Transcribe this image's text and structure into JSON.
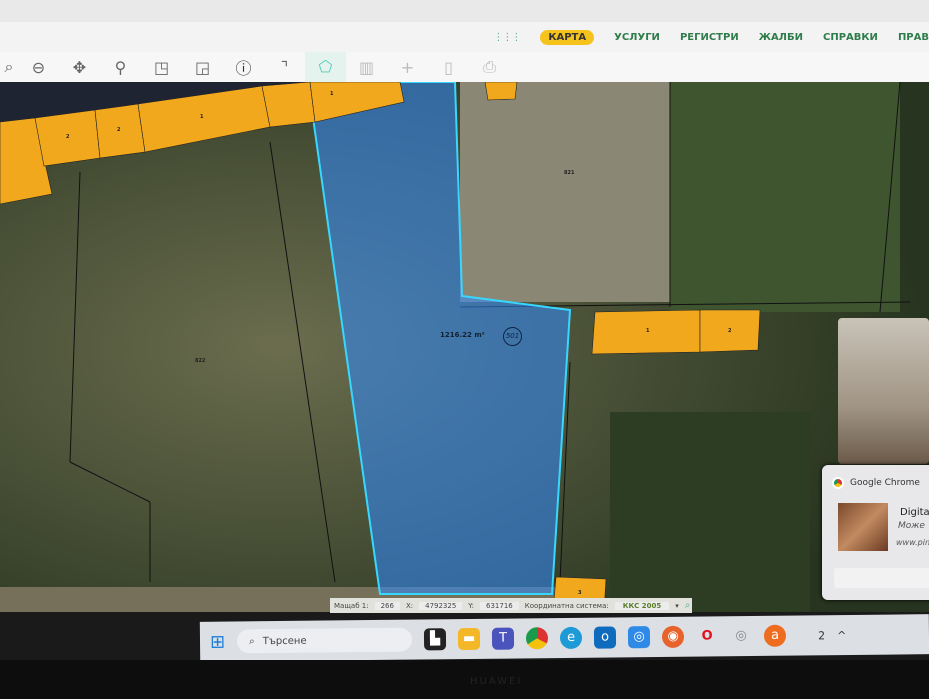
{
  "nav": {
    "items": [
      "КАРТА",
      "УСЛУГИ",
      "РЕГИСТРИ",
      "ЖАЛБИ",
      "СПРАВКИ",
      "ПРАВ"
    ],
    "active": "КАРТА",
    "accent": "#f6c31d",
    "link_color": "#2f7d4a"
  },
  "toolbar": {
    "tools": [
      "zoom-in",
      "zoom-out",
      "pan",
      "marker",
      "select-rect",
      "select-rect-2",
      "info",
      "measure-line",
      "measure-polygon",
      "map-layers",
      "crosshair",
      "document",
      "print"
    ],
    "active": "measure-polygon"
  },
  "map": {
    "parcel_labels": {
      "top_a": "2",
      "top_b": "2",
      "top_c": "1",
      "top_d": "1",
      "left_parcel": "822",
      "right_parcel": "821",
      "bld_r1": "1",
      "bld_r2": "2",
      "bld_bottom": "3"
    },
    "selected": {
      "area": "1216.22 m²",
      "number": "501",
      "highlight": "#2f8bff",
      "outline": "#38d7ff"
    },
    "building_color": "#f2a81d"
  },
  "status": {
    "scale_label": "Мащаб 1:",
    "scale": "266",
    "x_label": "X:",
    "x": "4792325",
    "y_label": "Y:",
    "y": "631716",
    "cs_label": "Координатна система:",
    "cs": "ККС 2005"
  },
  "notification": {
    "app": "Google Chrome",
    "title": "Digital",
    "line2": "Може",
    "url": "www.pin"
  },
  "taskbar": {
    "search_placeholder": "Търсене",
    "apps": [
      "file-explorer",
      "folder",
      "teams",
      "chrome",
      "edge",
      "outlook",
      "remote",
      "firefox",
      "opera",
      "webcam",
      "avast"
    ],
    "tray_badge": "2"
  },
  "device": {
    "brand": "HUAWEI"
  }
}
